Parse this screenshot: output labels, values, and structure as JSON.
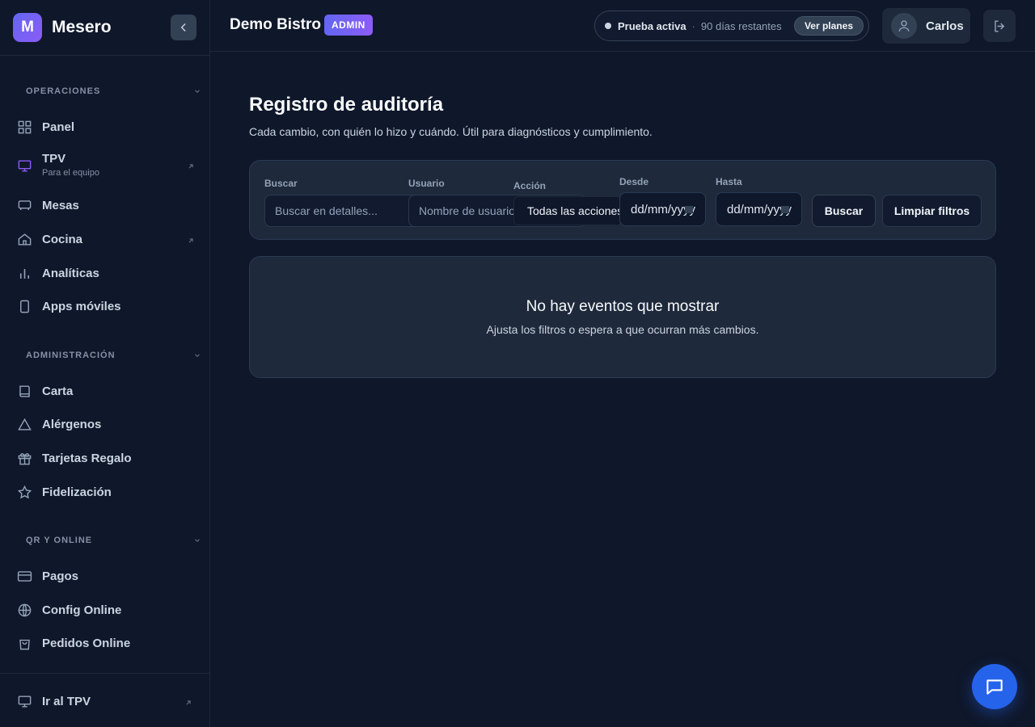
{
  "brand": {
    "logo_letter": "M",
    "name": "Mesero"
  },
  "sidebar": {
    "sections": [
      {
        "title": "OPERACIONES",
        "items": [
          {
            "label": "Panel",
            "icon": "grid-icon"
          },
          {
            "label": "TPV",
            "sub": "Para el equipo",
            "icon": "monitor-icon",
            "external": true
          },
          {
            "label": "Mesas",
            "icon": "table-icon"
          },
          {
            "label": "Cocina",
            "icon": "home-icon",
            "external": true
          },
          {
            "label": "Analíticas",
            "icon": "bar-chart-icon"
          },
          {
            "label": "Apps móviles",
            "icon": "smartphone-icon"
          }
        ]
      },
      {
        "title": "ADMINISTRACIÓN",
        "items": [
          {
            "label": "Carta",
            "icon": "book-icon"
          },
          {
            "label": "Alérgenos",
            "icon": "warning-icon"
          },
          {
            "label": "Tarjetas Regalo",
            "icon": "gift-icon"
          },
          {
            "label": "Fidelización",
            "icon": "star-icon"
          }
        ]
      },
      {
        "title": "QR Y ONLINE",
        "items": [
          {
            "label": "Pagos",
            "icon": "credit-card-icon"
          },
          {
            "label": "Config Online",
            "icon": "globe-icon"
          },
          {
            "label": "Pedidos Online",
            "icon": "shopping-bag-icon"
          }
        ]
      }
    ],
    "footer": {
      "label": "Ir al TPV",
      "icon": "monitor-icon"
    }
  },
  "topbar": {
    "business": "Demo Bistro",
    "role": "ADMIN",
    "trial": {
      "status": "Prueba activa",
      "separator": "·",
      "remaining": "90 días restantes",
      "cta": "Ver planes"
    },
    "user": "Carlos"
  },
  "page": {
    "title": "Registro de auditoría",
    "subtitle": "Cada cambio, con quién lo hizo y cuándo. Útil para diagnósticos y cumplimiento."
  },
  "filters": {
    "search": {
      "label": "Buscar",
      "placeholder": "Buscar en detalles..."
    },
    "user": {
      "label": "Usuario",
      "placeholder": "Nombre de usuario"
    },
    "action": {
      "label": "Acción",
      "value": "Todas las acciones"
    },
    "from": {
      "label": "Desde",
      "value": "dd/mm/yyyy"
    },
    "to": {
      "label": "Hasta",
      "value": "dd/mm/yyyy"
    },
    "search_button": "Buscar",
    "clear_button": "Limpiar filtros"
  },
  "empty_state": {
    "title": "No hay eventos que mostrar",
    "subtitle": "Ajusta los filtros o espera a que ocurran más cambios."
  },
  "colors": {
    "background": "#0f172a",
    "card": "#1e293b",
    "accent": "#6366f1",
    "fab": "#2563eb"
  }
}
